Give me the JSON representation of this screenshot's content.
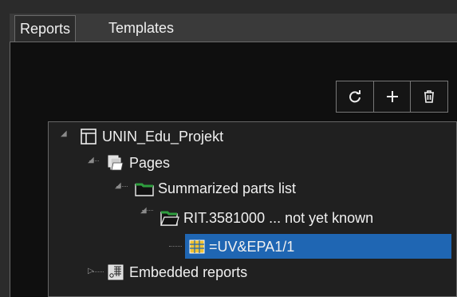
{
  "tabs": {
    "reports": "Reports",
    "templates": "Templates"
  },
  "toolbar": {
    "refresh_icon": "refresh-icon",
    "add_icon": "plus-icon",
    "delete_icon": "trash-icon"
  },
  "tree": {
    "root": "UNIN_Edu_Projekt",
    "pages": "Pages",
    "summarized": "Summarized parts list",
    "rit": "RIT.3581000 ... not yet known",
    "item": "=UV&EPA1/1",
    "embedded": "Embedded reports"
  },
  "colors": {
    "selection": "#1f66b3",
    "folder_green": "#2e9e3e"
  }
}
